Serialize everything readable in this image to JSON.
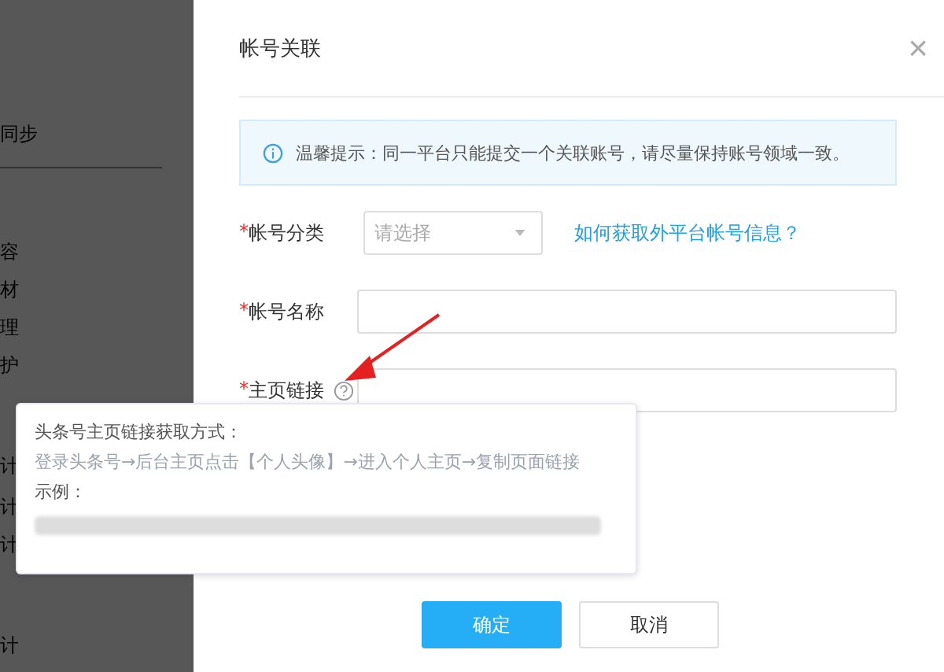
{
  "background_sidebar": {
    "items": [
      "同步",
      "容",
      "材",
      "理",
      "护",
      "计",
      "计",
      "计",
      "计"
    ]
  },
  "dialog": {
    "title": "帐号关联",
    "close": "×",
    "notice": "温馨提示：同一平台只能提交一个关联账号，请尽量保持账号领域一致。",
    "fields": [
      {
        "kind": "select",
        "required_mark": "*",
        "label": "帐号分类",
        "placeholder": "请选择",
        "link": "如何获取外平台帐号信息？"
      },
      {
        "kind": "text",
        "required_mark": "*",
        "label": "帐号名称"
      },
      {
        "kind": "text",
        "required_mark": "*",
        "label": "主页链接",
        "help": true
      }
    ],
    "buttons": [
      {
        "label": "确定",
        "kind": "primary"
      },
      {
        "label": "取消",
        "kind": "default"
      }
    ]
  },
  "tooltip": {
    "title": "头条号主页链接获取方式：",
    "steps": "登录头条号→后台主页点击【个人头像】→进入个人主页→复制页面链接",
    "example_label": "示例：",
    "example_redacted": true
  }
}
